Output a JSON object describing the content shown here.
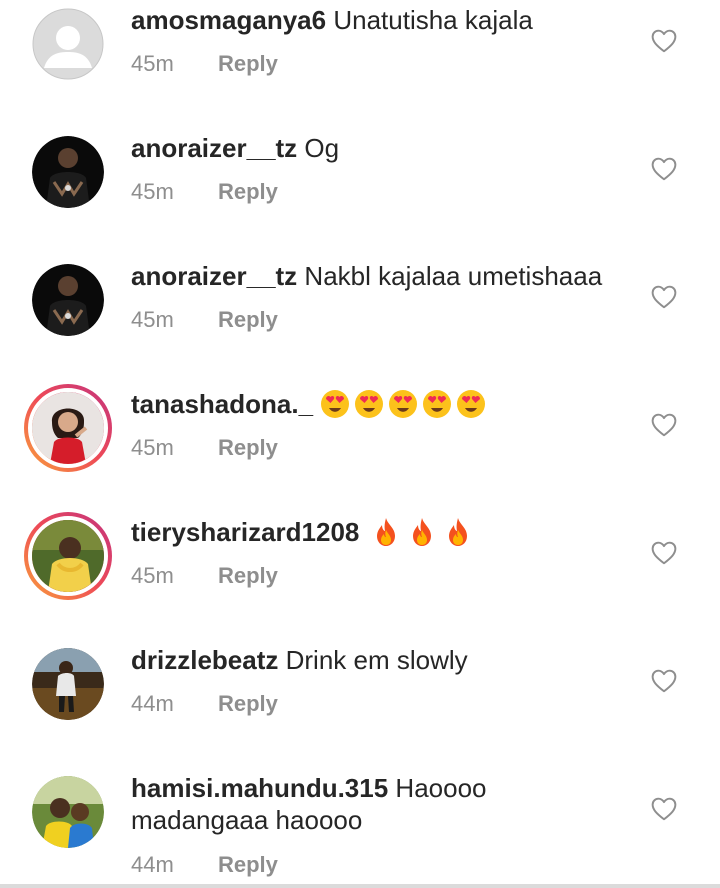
{
  "comments": [
    {
      "username": "amosmaganya6",
      "text": "Unatutisha kajala",
      "time": "45m",
      "reply_label": "Reply",
      "avatar": "default-avatar-icon",
      "story_ring": false
    },
    {
      "username": "anoraizer__tz",
      "text": "Og",
      "time": "45m",
      "reply_label": "Reply",
      "avatar": "user-photo",
      "story_ring": false
    },
    {
      "username": "anoraizer__tz",
      "text": "Nakbl kajalaa umetishaaa",
      "time": "45m",
      "reply_label": "Reply",
      "avatar": "user-photo",
      "story_ring": false
    },
    {
      "username": "tanashadona._",
      "text": "",
      "emojis": [
        "heart-eyes-emoji",
        "heart-eyes-emoji",
        "heart-eyes-emoji",
        "heart-eyes-emoji",
        "heart-eyes-emoji"
      ],
      "time": "45m",
      "reply_label": "Reply",
      "avatar": "user-photo",
      "story_ring": true
    },
    {
      "username": "tierysharizard1208",
      "text": "",
      "emojis": [
        "fire-emoji",
        "fire-emoji",
        "fire-emoji"
      ],
      "time": "45m",
      "reply_label": "Reply",
      "avatar": "user-photo",
      "story_ring": true
    },
    {
      "username": "drizzlebeatz",
      "text": "Drink em slowly",
      "time": "44m",
      "reply_label": "Reply",
      "avatar": "user-photo",
      "story_ring": false
    },
    {
      "username": "hamisi.mahundu.315",
      "text": "Haoooo madangaaa haoooo",
      "time": "44m",
      "reply_label": "Reply",
      "avatar": "user-photo",
      "story_ring": false
    }
  ],
  "colors": {
    "text": "#262626",
    "muted": "#8e8e8e",
    "story_ring_start": "#f9a23b",
    "story_ring_end": "#c2337f"
  }
}
